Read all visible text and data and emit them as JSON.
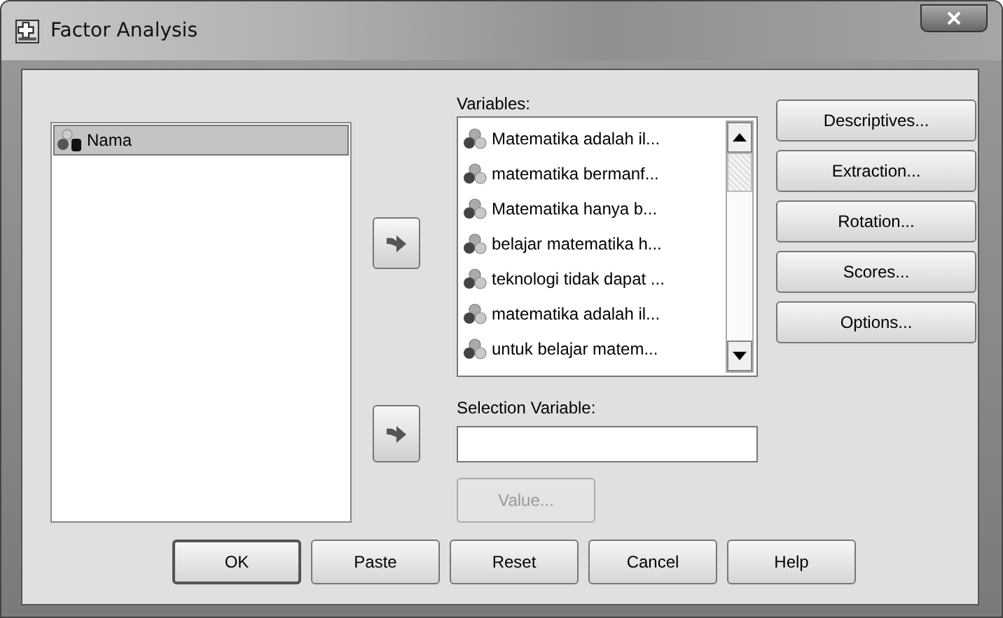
{
  "window": {
    "title": "Factor Analysis"
  },
  "source_list": {
    "items": [
      {
        "label": "Nama",
        "kind": "string",
        "selected": true
      }
    ]
  },
  "arrow_buttons": [
    {
      "kind": "variables"
    },
    {
      "kind": "selection"
    }
  ],
  "variables": {
    "label": "Variables:",
    "items": [
      {
        "label": "Matematika adalah il...",
        "kind": "scale"
      },
      {
        "label": "matematika bermanf...",
        "kind": "scale"
      },
      {
        "label": "Matematika hanya b...",
        "kind": "scale"
      },
      {
        "label": "belajar matematika h...",
        "kind": "scale"
      },
      {
        "label": "teknologi tidak dapat ...",
        "kind": "scale"
      },
      {
        "label": "matematika adalah il...",
        "kind": "scale"
      },
      {
        "label": "untuk belajar matem...",
        "kind": "scale"
      }
    ]
  },
  "selection_variable": {
    "label": "Selection Variable:",
    "value_button": {
      "label": "Value...",
      "disabled": true
    }
  },
  "side_buttons": [
    {
      "label": "Descriptives...",
      "disabled": false
    },
    {
      "label": "Extraction...",
      "disabled": false
    },
    {
      "label": "Rotation...",
      "disabled": false
    },
    {
      "label": "Scores...",
      "disabled": false
    },
    {
      "label": "Options...",
      "disabled": false
    }
  ],
  "bottom_buttons": [
    {
      "label": "OK",
      "default": true
    },
    {
      "label": "Paste",
      "default": false
    },
    {
      "label": "Reset",
      "default": false
    },
    {
      "label": "Cancel",
      "default": false
    },
    {
      "label": "Help",
      "default": false
    }
  ]
}
